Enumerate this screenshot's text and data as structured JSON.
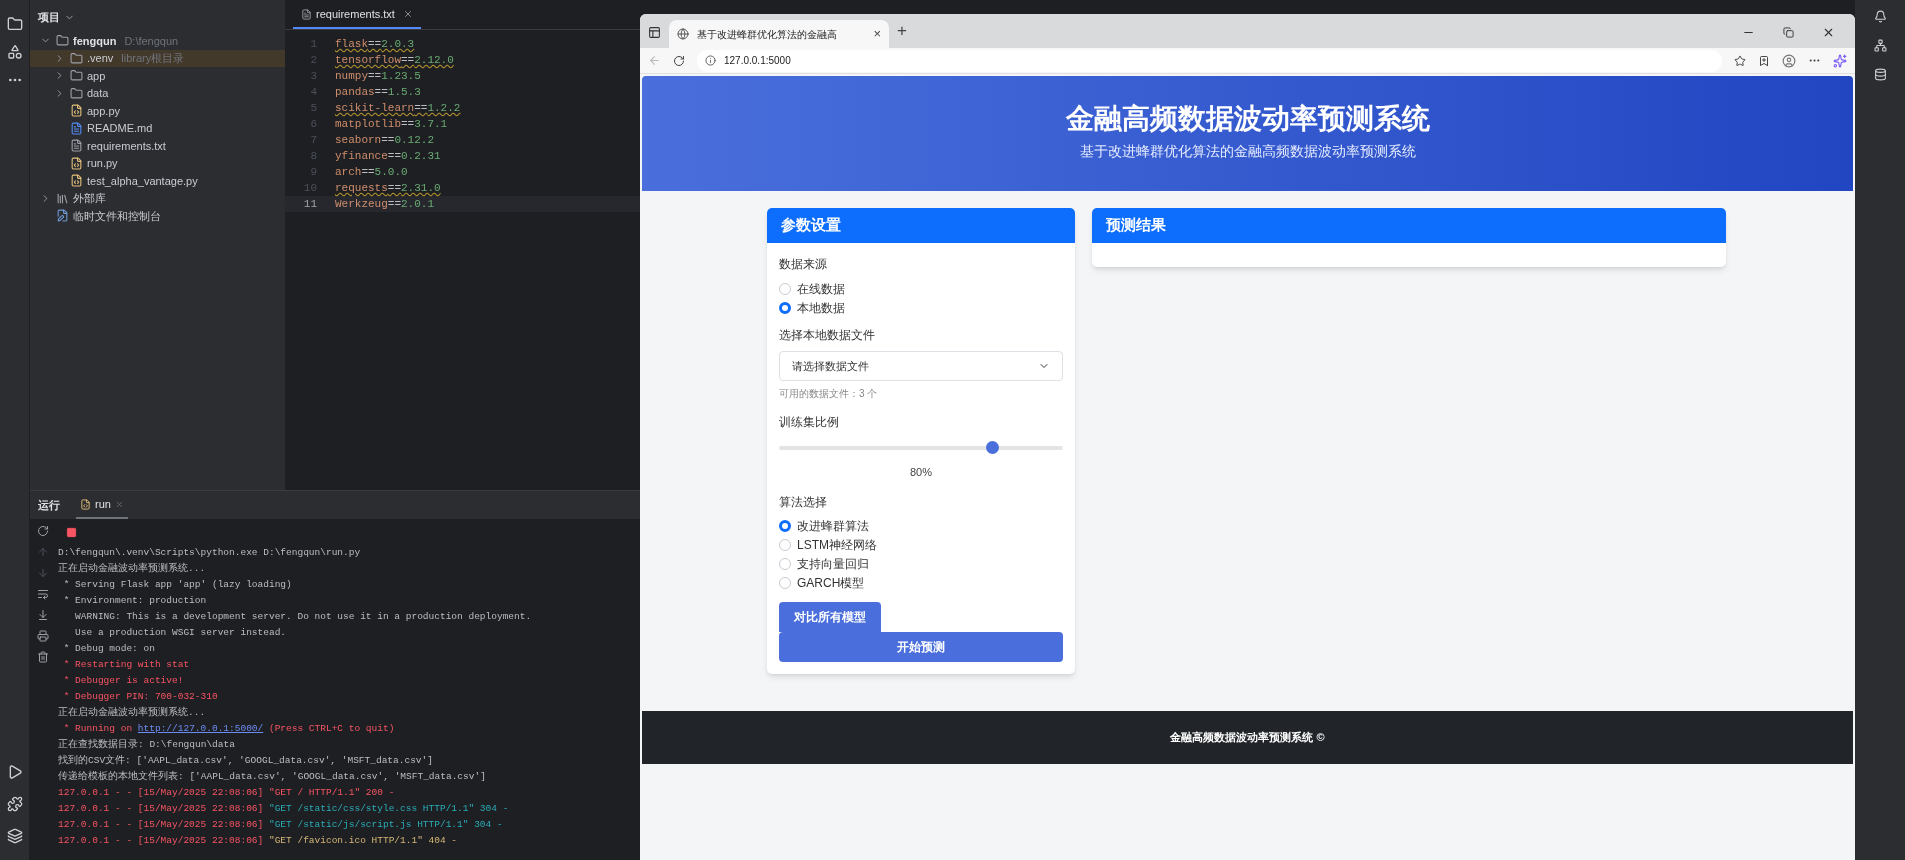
{
  "project_panel": {
    "title": "项目",
    "tree": [
      {
        "label": "fengqun",
        "hint": "D:\\fengqun",
        "kind": "folder",
        "expanded": true,
        "selected": false,
        "children": [
          {
            "label": ".venv",
            "hint": "library根目录",
            "kind": "folder",
            "expanded": false,
            "selected": true
          },
          {
            "label": "app",
            "kind": "folder",
            "expanded": false,
            "selected": false
          },
          {
            "label": "data",
            "kind": "folder",
            "expanded": false,
            "selected": false
          },
          {
            "label": "app.py",
            "kind": "python",
            "selected": false
          },
          {
            "label": "README.md",
            "kind": "markdown",
            "selected": false
          },
          {
            "label": "requirements.txt",
            "kind": "text",
            "selected": false
          },
          {
            "label": "run.py",
            "kind": "python",
            "selected": false
          },
          {
            "label": "test_alpha_vantage.py",
            "kind": "python",
            "selected": false
          }
        ]
      },
      {
        "label": "外部库",
        "kind": "library",
        "expanded": false,
        "selected": false
      },
      {
        "label": "临时文件和控制台",
        "kind": "scratch",
        "selected": false
      }
    ]
  },
  "editor": {
    "tab": "requirements.txt",
    "lines": [
      {
        "number": "1",
        "package": "flask",
        "operator": "==",
        "version": "2.0.3",
        "warning": true,
        "current": false
      },
      {
        "number": "2",
        "package": "tensorflow",
        "operator": "==",
        "version": "2.12.0",
        "warning": true,
        "current": false
      },
      {
        "number": "3",
        "package": "numpy",
        "operator": "==",
        "version": "1.23.5",
        "warning": false,
        "current": false
      },
      {
        "number": "4",
        "package": "pandas",
        "operator": "==",
        "version": "1.5.3",
        "warning": false,
        "current": false
      },
      {
        "number": "5",
        "package": "scikit-learn",
        "operator": "==",
        "version": "1.2.2",
        "warning": true,
        "current": false
      },
      {
        "number": "6",
        "package": "matplotlib",
        "operator": "==",
        "version": "3.7.1",
        "warning": false,
        "current": false
      },
      {
        "number": "7",
        "package": "seaborn",
        "operator": "==",
        "version": "0.12.2",
        "warning": false,
        "current": false
      },
      {
        "number": "8",
        "package": "yfinance",
        "operator": "==",
        "version": "0.2.31",
        "warning": false,
        "current": false
      },
      {
        "number": "9",
        "package": "arch",
        "operator": "==",
        "version": "5.0.0",
        "warning": false,
        "current": false
      },
      {
        "number": "10",
        "package": "requests",
        "operator": "==",
        "version": "2.31.0",
        "warning": true,
        "current": false
      },
      {
        "number": "11",
        "package": "Werkzeug",
        "operator": "==",
        "version": "2.0.1",
        "warning": false,
        "current": true
      }
    ]
  },
  "run_panel": {
    "title": "运行",
    "tab": "run",
    "lines": [
      [
        {
          "text": "D:\\fengqun\\.venv\\Scripts\\python.exe D:\\fengqun\\run.py",
          "kind": "plain"
        }
      ],
      [
        {
          "text": "正在启动金融波动率预测系统...",
          "kind": "plain"
        }
      ],
      [
        {
          "text": " * Serving Flask app 'app' (lazy loading)",
          "kind": "plain"
        }
      ],
      [
        {
          "text": " * Environment: production",
          "kind": "plain"
        }
      ],
      [
        {
          "text": "   WARNING: This is a development server. Do not use it in a production deployment.",
          "kind": "plain"
        }
      ],
      [
        {
          "text": "   Use a production WSGI server instead.",
          "kind": "plain"
        }
      ],
      [
        {
          "text": " * Debug mode: on",
          "kind": "plain"
        }
      ],
      [
        {
          "text": " * Restarting with stat",
          "kind": "error"
        }
      ],
      [
        {
          "text": " * Debugger is active!",
          "kind": "error"
        }
      ],
      [
        {
          "text": " * Debugger PIN: 700-032-310",
          "kind": "error"
        }
      ],
      [
        {
          "text": "正在启动金融波动率预测系统...",
          "kind": "plain"
        }
      ],
      [
        {
          "text": " * Running on ",
          "kind": "error"
        },
        {
          "text": "http://127.0.0.1:5000/",
          "kind": "link"
        },
        {
          "text": " (Press CTRL+C to quit)",
          "kind": "error"
        }
      ],
      [
        {
          "text": "正在查找数据目录: D:\\fengqun\\data",
          "kind": "plain"
        }
      ],
      [
        {
          "text": "找到的CSV文件: ['AAPL_data.csv', 'GOOGL_data.csv', 'MSFT_data.csv']",
          "kind": "plain"
        }
      ],
      [
        {
          "text": "传递给模板的本地文件列表: ['AAPL_data.csv', 'GOOGL_data.csv', 'MSFT_data.csv']",
          "kind": "plain"
        }
      ],
      [
        {
          "text": "127.0.0.1 - - [15/May/2025 22:08:06] \"GET / HTTP/1.1\" 200 -",
          "kind": "error"
        }
      ],
      [
        {
          "text": "127.0.0.1 - - [15/May/2025 22:08:06] ",
          "kind": "error"
        },
        {
          "text": "\"GET /static/css/style.css HTTP/1.1\" 304 -",
          "kind": "cached"
        }
      ],
      [
        {
          "text": "127.0.0.1 - - [15/May/2025 22:08:06] ",
          "kind": "error"
        },
        {
          "text": "\"GET /static/js/script.js HTTP/1.1\" 304 -",
          "kind": "cached"
        }
      ],
      [
        {
          "text": "127.0.0.1 - - [15/May/2025 22:08:06] ",
          "kind": "error"
        },
        {
          "text": "\"GET /favicon.ico HTTP/1.1\" 404 -",
          "kind": "missing"
        }
      ]
    ]
  },
  "browser": {
    "tab_title": "基于改进蜂群优化算法的金融高",
    "tab_close": "×",
    "new_tab": "+",
    "url": "127.0.0.1:5000",
    "page": {
      "title": "金融高频数据波动率预测系统",
      "subtitle": "基于改进蜂群优化算法的金融高频数据波动率预测系统",
      "settings_card": {
        "title": "参数设置",
        "source_label": "数据来源",
        "sources": [
          {
            "label": "在线数据",
            "selected": false
          },
          {
            "label": "本地数据",
            "selected": true
          }
        ],
        "file_label": "选择本地数据文件",
        "file_select": "请选择数据文件",
        "file_hint": "可用的数据文件：3 个",
        "ratio_label": "训练集比例",
        "ratio": {
          "level": 0.75,
          "reading": "80%"
        },
        "algo_label": "算法选择",
        "algorithms": [
          {
            "label": "改进蜂群算法",
            "selected": true
          },
          {
            "label": "LSTM神经网络",
            "selected": false
          },
          {
            "label": "支持向量回归",
            "selected": false
          },
          {
            "label": "GARCH模型",
            "selected": false
          }
        ],
        "compare_button": "对比所有模型",
        "start_button": "开始预测"
      },
      "results_card": {
        "title": "预测结果"
      },
      "footer": "金融高频数据波动率预测系统 ©"
    }
  }
}
